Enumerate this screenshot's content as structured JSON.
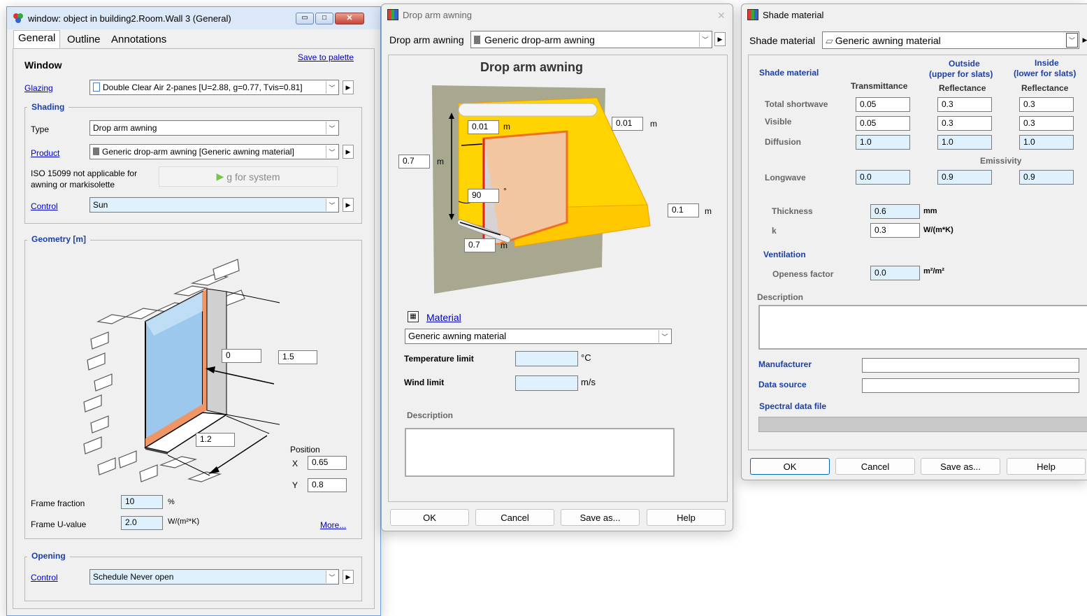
{
  "window1": {
    "title": "window: object in building2.Room.Wall 3 (General)",
    "tabs": [
      "General",
      "Outline",
      "Annotations"
    ],
    "save_to_palette": "Save to palette",
    "heading": "Window",
    "glazing_label": "Glazing",
    "glazing_value": "Double Clear Air 2-panes [U=2.88, g=0.77, Tvis=0.81]",
    "shading_title": "Shading",
    "type_label": "Type",
    "type_value": "Drop arm awning",
    "product_label": "Product",
    "product_value": "Generic drop-arm awning [Generic awning material]",
    "iso_note_1": "ISO 15099 not applicable for",
    "iso_note_2": "awning or markisolette",
    "g_system": "g for system",
    "control_label": "Control",
    "control_value": "Sun",
    "geometry_title": "Geometry [m]",
    "geo_depth": "0",
    "geo_height": "1.5",
    "geo_width": "1.2",
    "position_label": "Position",
    "x_label": "X",
    "x_value": "0.65",
    "y_label": "Y",
    "y_value": "0.8",
    "frame_fraction_label": "Frame fraction",
    "frame_fraction_value": "10",
    "frame_fraction_unit": "%",
    "frame_u_label": "Frame U-value",
    "frame_u_value": "2.0",
    "frame_u_unit": "W/(m²*K)",
    "more_link": "More...",
    "opening_title": "Opening",
    "opening_control_label": "Control",
    "opening_control_value": "Schedule Never open"
  },
  "window2": {
    "title": "Drop arm awning",
    "combo_label": "Drop arm awning",
    "combo_value": "Generic drop-arm awning",
    "heading": "Drop arm awning",
    "d_top": "0.01",
    "d_top_unit": "m",
    "d_right_top": "0.01",
    "d_right_top_unit": "m",
    "d_left": "0.7",
    "d_left_unit": "m",
    "angle": "90",
    "angle_unit": "°",
    "d_right_bottom": "0.1",
    "d_right_bottom_unit": "m",
    "d_bottom": "0.7",
    "d_bottom_unit": "m",
    "material_link": "Material",
    "material_value": "Generic awning material",
    "temp_label": "Temperature limit",
    "temp_unit": "°C",
    "wind_label": "Wind limit",
    "wind_unit": "m/s",
    "description_label": "Description",
    "buttons": [
      "OK",
      "Cancel",
      "Save as...",
      "Help"
    ]
  },
  "window3": {
    "title": "Shade material",
    "combo_label": "Shade material",
    "combo_value": "Generic awning material",
    "section_label": "Shade material",
    "col_transmittance": "Transmittance",
    "col_outside_1": "Outside",
    "col_outside_2": "(upper for slats)",
    "col_outside_3": "Reflectance",
    "col_inside_1": "Inside",
    "col_inside_2": "(lower for slats)",
    "col_inside_3": "Reflectance",
    "rows": [
      {
        "label": "Total shortwave",
        "t": "0.05",
        "o": "0.3",
        "i": "0.3"
      },
      {
        "label": "Visible",
        "t": "0.05",
        "o": "0.3",
        "i": "0.3"
      },
      {
        "label": "Diffusion",
        "t": "1.0",
        "o": "1.0",
        "i": "1.0"
      }
    ],
    "emissivity_label": "Emissivity",
    "longwave_label": "Longwave",
    "longwave": {
      "t": "0.0",
      "o": "0.9",
      "i": "0.9"
    },
    "thickness_label": "Thickness",
    "thickness_value": "0.6",
    "thickness_unit": "mm",
    "k_label": "k",
    "k_value": "0.3",
    "k_unit": "W/(m*K)",
    "ventilation_label": "Ventilation",
    "openess_label": "Openess factor",
    "openess_value": "0.0",
    "openess_unit": "m²/m²",
    "description_label": "Description",
    "manufacturer_label": "Manufacturer",
    "data_source_label": "Data source",
    "spectral_label": "Spectral data file",
    "buttons": [
      "OK",
      "Cancel",
      "Save as...",
      "Help"
    ]
  }
}
